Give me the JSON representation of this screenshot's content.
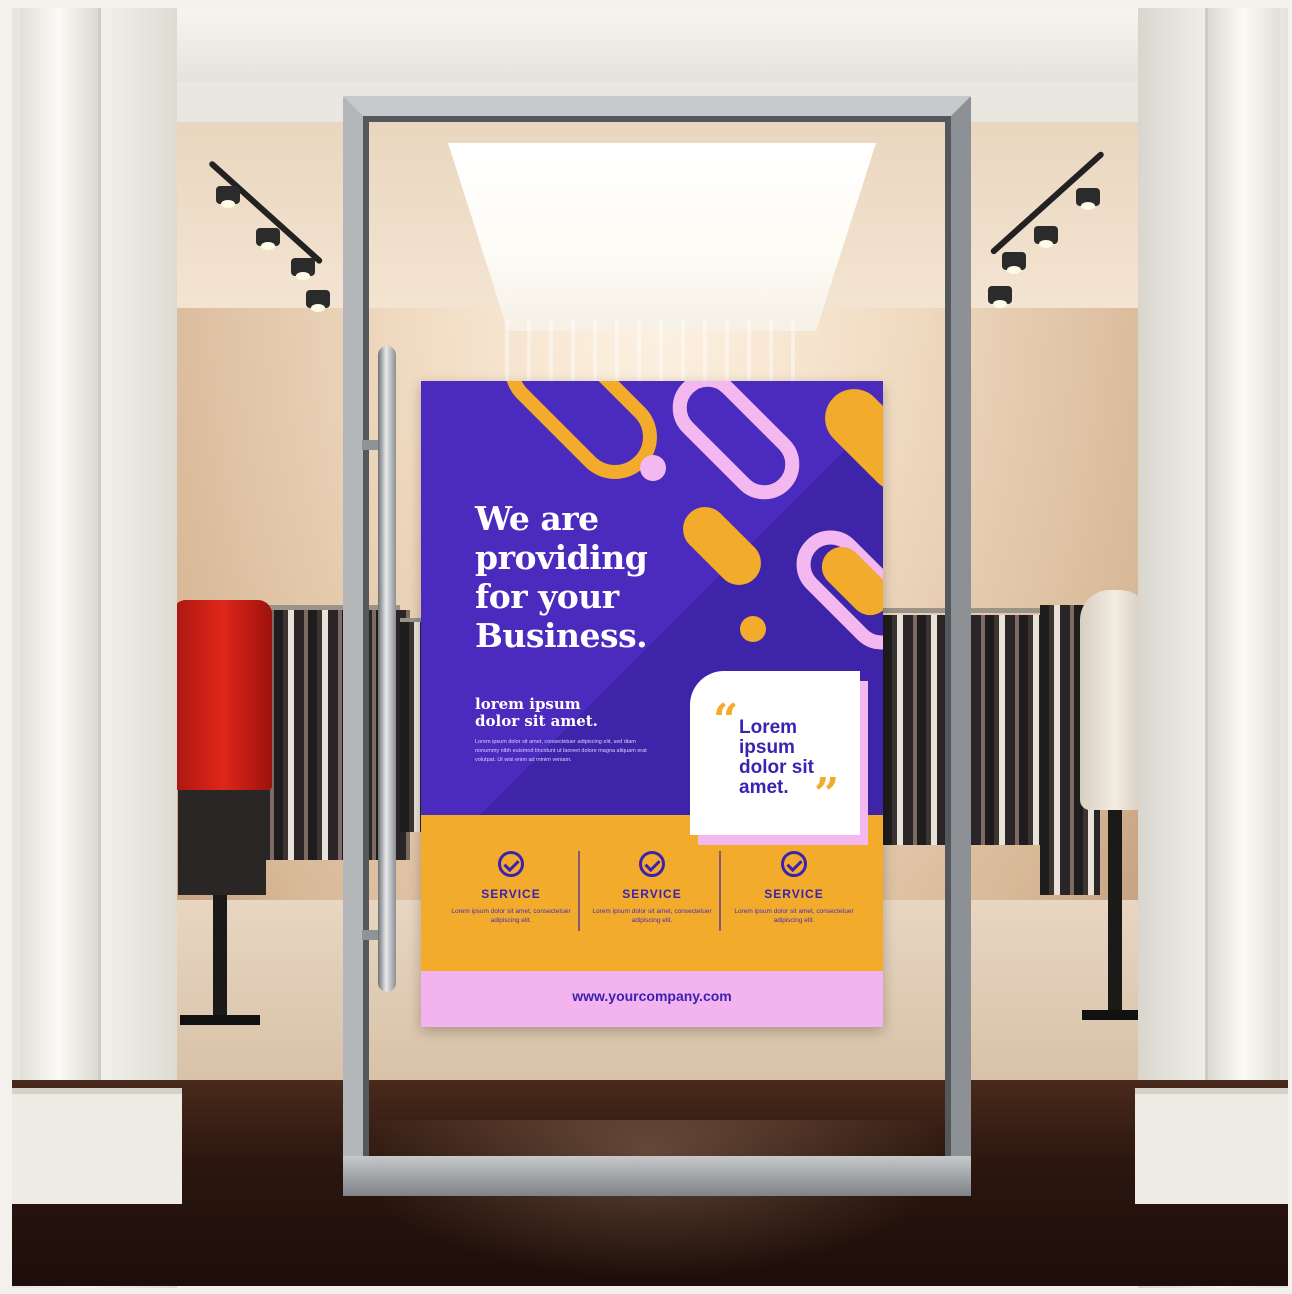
{
  "poster": {
    "headline_lines": [
      "We are",
      "providing",
      "for your",
      "Business."
    ],
    "sub_heading_lines": [
      "lorem ipsum",
      "dolor sit amet."
    ],
    "body_text": "Lorem ipsum dolor sit amet, consectetuer adipiscing elit, sed diam nonummy nibh euismod tincidunt ut laoreet dolore magna aliquam erat volutpat. Ut wisi enim ad minim veniam.",
    "quote_lines": [
      "Lorem",
      "ipsum",
      "dolor sit",
      "amet."
    ],
    "quote_open": "“",
    "quote_close": "”",
    "services": [
      {
        "title": "SERVICE",
        "description": "Lorem ipsum dolor sit amet, consectetuer adipiscing elit."
      },
      {
        "title": "SERVICE",
        "description": "Lorem ipsum dolor sit amet, consectetuer adipiscing elit."
      },
      {
        "title": "SERVICE",
        "description": "Lorem ipsum dolor sit amet, consectetuer adipiscing elit."
      }
    ],
    "website": "www.yourcompany.com",
    "colors": {
      "purple": "#4a2bbe",
      "orange": "#f3ab2c",
      "pink": "#f2b3ee",
      "white": "#ffffff"
    },
    "icons": [
      "check-circle-icon",
      "check-circle-icon",
      "check-circle-icon"
    ]
  }
}
